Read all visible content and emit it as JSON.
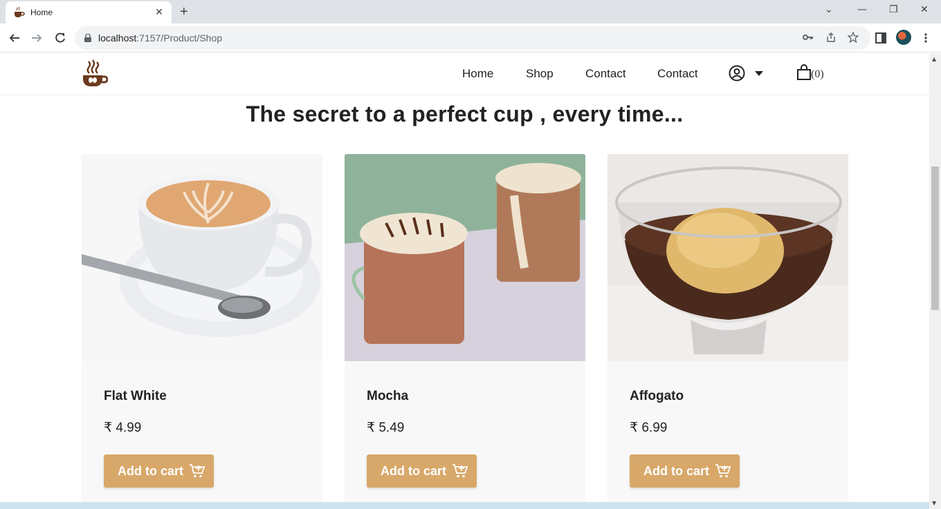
{
  "browser": {
    "tab_title": "Home",
    "tab_close": "✕",
    "new_tab": "+",
    "url_host": "localhost",
    "url_path": ":7157/Product/Shop",
    "win_min": "—",
    "win_restore": "❐",
    "win_close": "✕",
    "tab_list": "⌄"
  },
  "site": {
    "nav": [
      "Home",
      "Shop",
      "Contact",
      "Contact"
    ],
    "cart_count": "(0)",
    "tagline": "The secret to a perfect cup , every time..."
  },
  "products": [
    {
      "name": "Flat White",
      "price": "₹ 4.99",
      "button": "Add to cart"
    },
    {
      "name": "Mocha",
      "price": "₹ 5.49",
      "button": "Add to cart"
    },
    {
      "name": "Affogato",
      "price": "₹ 6.99",
      "button": "Add to cart"
    }
  ],
  "colors": {
    "accent": "#d8a86a",
    "card_bg": "#f8f8f8",
    "logo_brown": "#6b3a1f"
  }
}
